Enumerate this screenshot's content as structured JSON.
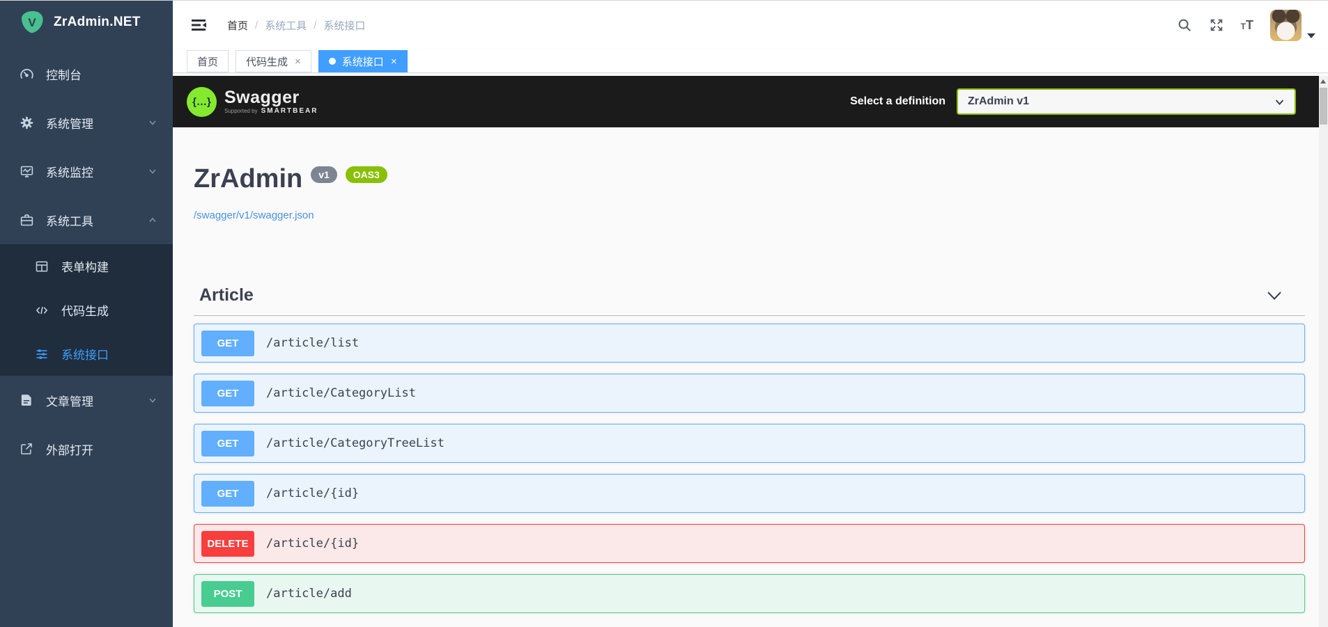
{
  "app": {
    "name": "ZrAdmin.NET"
  },
  "sidebar": {
    "items": {
      "dashboard": "控制台",
      "system": "系统管理",
      "monitor": "系统监控",
      "tools": "系统工具",
      "form_builder": "表单构建",
      "code_gen": "代码生成",
      "api_docs": "系统接口",
      "articles": "文章管理",
      "external": "外部打开"
    }
  },
  "navbar": {
    "breadcrumb": {
      "home": "首页",
      "level1": "系统工具",
      "level2": "系统接口",
      "separator": "/"
    },
    "font_icon": {
      "t_small": "T",
      "t_large": "T"
    }
  },
  "tabs": {
    "home": "首页",
    "code_gen": "代码生成",
    "api_docs": "系统接口",
    "close_glyph": "×"
  },
  "swagger": {
    "topbar": {
      "logo_glyph": "{…}",
      "logo_text": "Swagger",
      "supported_by": "Supported by",
      "smartbear": "SMARTBEAR",
      "select_label": "Select a definition",
      "selected_definition": "ZrAdmin v1"
    },
    "info": {
      "title": "ZrAdmin",
      "version_badge": "v1",
      "oas_badge": "OAS3",
      "spec_url": "/swagger/v1/swagger.json"
    },
    "tag": "Article",
    "operations": [
      {
        "method": "GET",
        "path": "/article/list"
      },
      {
        "method": "GET",
        "path": "/article/CategoryList"
      },
      {
        "method": "GET",
        "path": "/article/CategoryTreeList"
      },
      {
        "method": "GET",
        "path": "/article/{id}"
      },
      {
        "method": "DELETE",
        "path": "/article/{id}"
      },
      {
        "method": "POST",
        "path": "/article/add"
      }
    ]
  },
  "colors": {
    "accent": "#409eff",
    "sidebar": "#304156",
    "submenu": "#1f2d3d",
    "topbar": "#1b1b1b",
    "get": "#61affe",
    "post": "#49cc90",
    "delete": "#f93e3e",
    "oas_green": "#89bf04"
  }
}
